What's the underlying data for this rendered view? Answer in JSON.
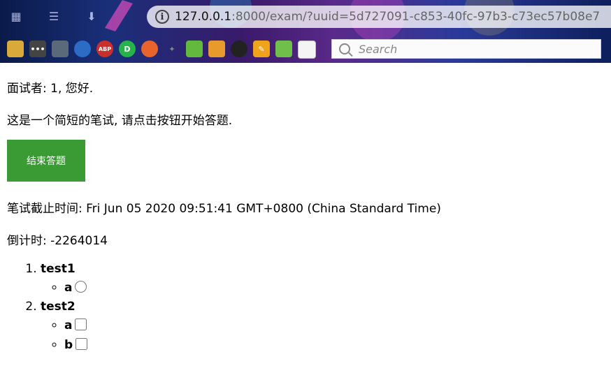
{
  "browser": {
    "url_host": "127.0.0.1",
    "url_path": ":8000/exam/?uuid=5d727091-c853-40fc-97b3-c73ec57b08e7",
    "info_icon": "i",
    "search_placeholder": "Search"
  },
  "page": {
    "greeting": "面试者: 1, 您好.",
    "intro": "这是一个简短的笔试, 请点击按钮开始答题.",
    "end_button_label": "结束答题",
    "deadline": "笔试截止时间: Fri Jun 05 2020 09:51:41 GMT+0800 (China Standard Time)",
    "countdown": "倒计时: -2264014",
    "questions": [
      {
        "title": "test1",
        "type": "radio",
        "options": [
          "a"
        ]
      },
      {
        "title": "test2",
        "type": "checkbox",
        "options": [
          "a",
          "b"
        ]
      }
    ]
  },
  "colors": {
    "end_button": "#3a9b35"
  }
}
